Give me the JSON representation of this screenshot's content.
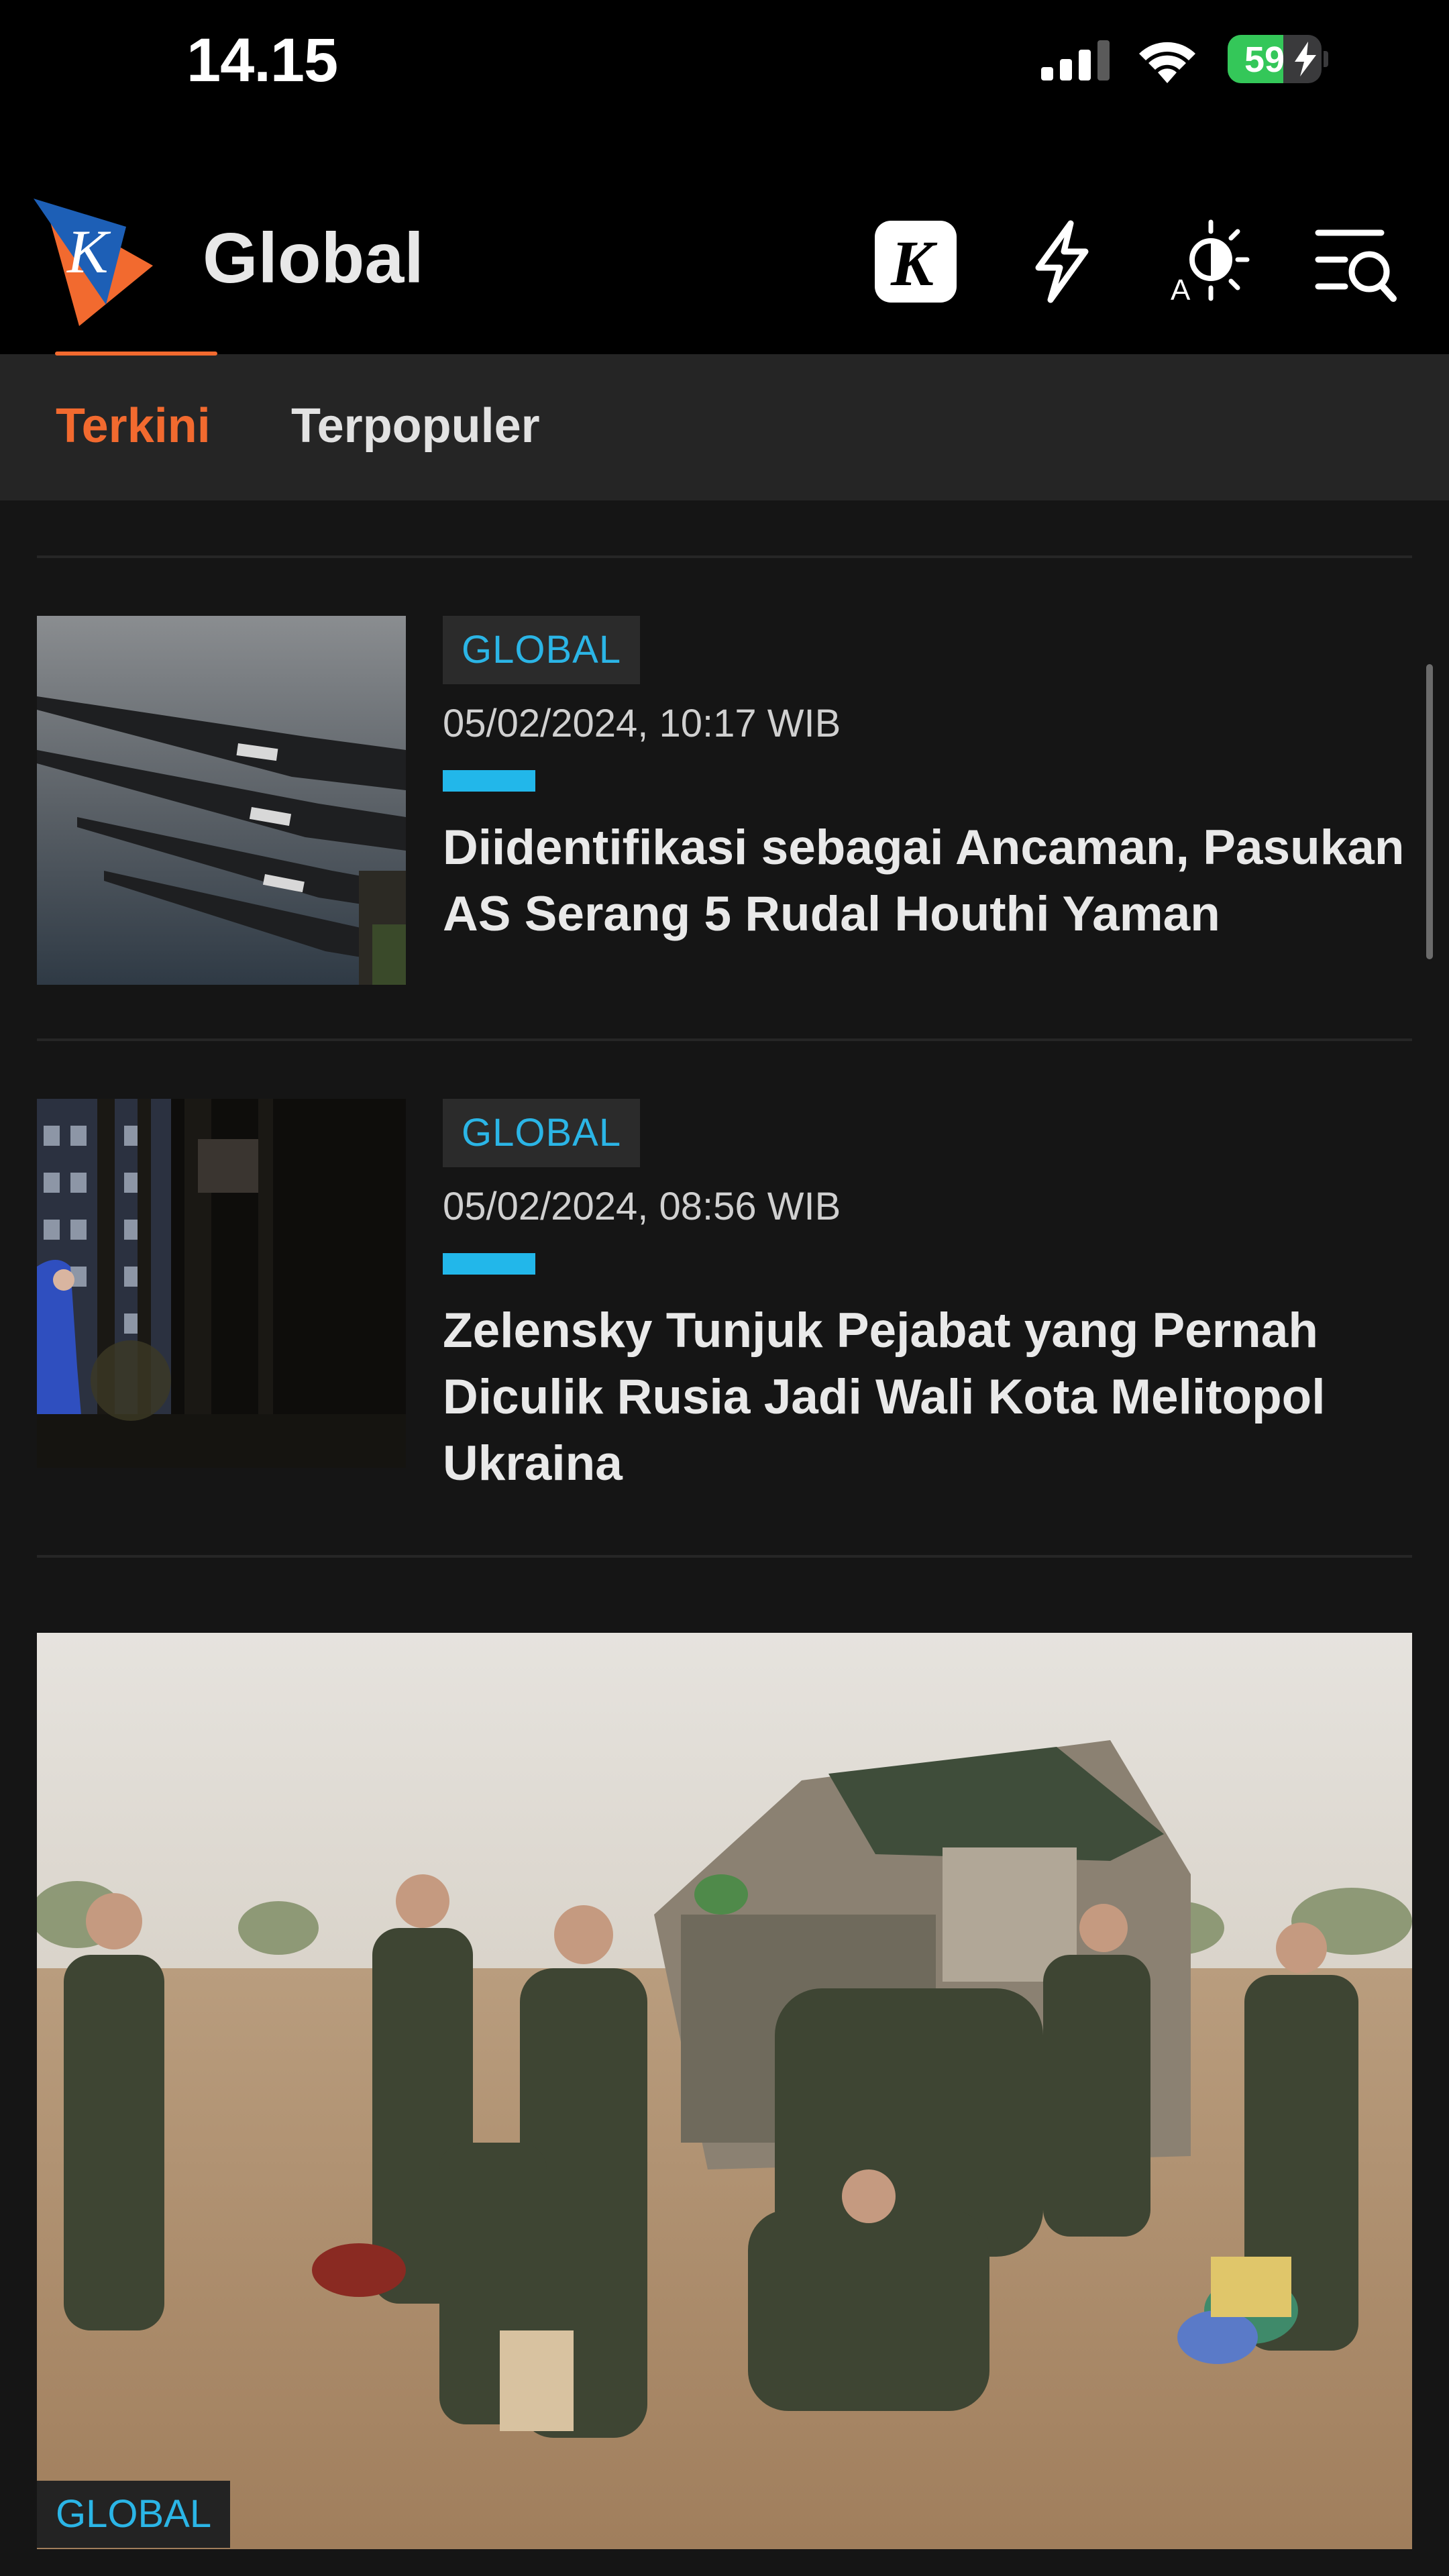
{
  "status_bar": {
    "time": "14.15",
    "battery_percent": "59",
    "battery_level": 0.59,
    "charging": true,
    "signal_bars": 3,
    "icons": [
      "cellular-signal-icon",
      "wifi-icon",
      "battery-charging-icon"
    ]
  },
  "header": {
    "logo_letter": "K",
    "title": "Global",
    "actions": [
      {
        "name": "kompas-k-button",
        "icon": "k-logo-icon"
      },
      {
        "name": "flash-button",
        "icon": "lightning-icon"
      },
      {
        "name": "theme-toggle-button",
        "icon": "brightness-icon"
      },
      {
        "name": "menu-search-button",
        "icon": "menu-search-icon"
      }
    ]
  },
  "tabs": [
    {
      "label": "Terkini",
      "active": true
    },
    {
      "label": "Terpopuler",
      "active": false
    }
  ],
  "articles": [
    {
      "category": "GLOBAL",
      "date": "05/02/2024, 10:17 WIB",
      "title": "Diidentifikasi sebagai Ancaman, Pasukan AS Serang 5 Rudal Houthi Yaman"
    },
    {
      "category": "GLOBAL",
      "date": "05/02/2024, 08:56 WIB",
      "title": "Zelensky Tunjuk Pejabat yang Pernah Diculik Rusia Jadi Wali Kota Melitopol Ukraina"
    }
  ],
  "hero": {
    "category": "GLOBAL"
  },
  "colors": {
    "accent_orange": "#f26a2f",
    "accent_blue": "#22b7ea",
    "background": "#151515",
    "header_bg": "#000000",
    "tab_bar_bg": "#252525"
  }
}
